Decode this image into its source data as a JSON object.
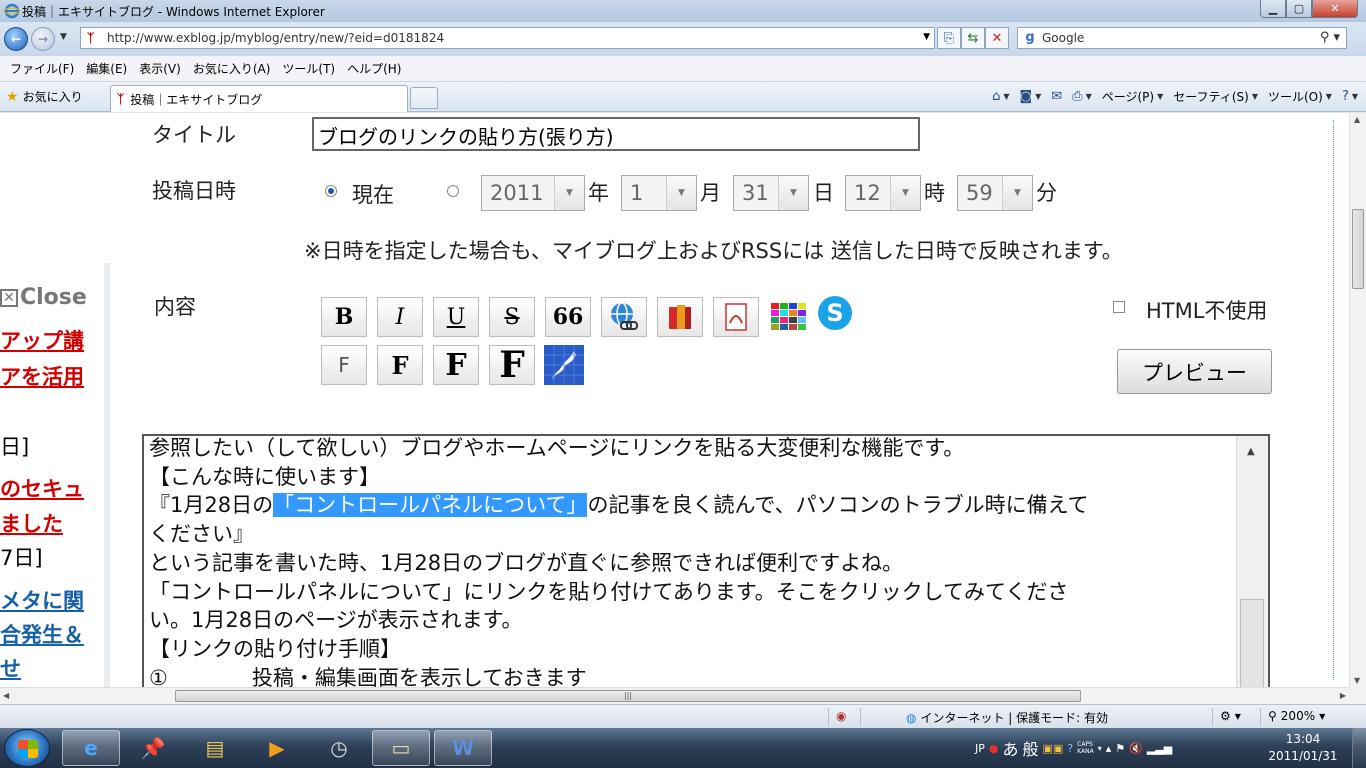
{
  "window": {
    "title": "投稿｜エキサイトブログ - Windows Internet Explorer"
  },
  "address_bar": {
    "url": "http://www.exblog.jp/myblog/entry/new/?eid=d0181824",
    "search_placeholder": "Google"
  },
  "menu": {
    "items": [
      "ファイル(F)",
      "編集(E)",
      "表示(V)",
      "お気に入り(A)",
      "ツール(T)",
      "ヘルプ(H)"
    ]
  },
  "favorites_bar": {
    "favorites_label": "お気に入り",
    "tab_label": "投稿｜エキサイトブログ",
    "page_menu": "ページ(P)",
    "safety_menu": "セーフティ(S)",
    "tools_menu": "ツール(O)"
  },
  "left_panel": {
    "close_label": "Close",
    "items": [
      {
        "text": "アップ講",
        "style": "red"
      },
      {
        "text": "アを活用",
        "style": "red"
      },
      {
        "text": "日]",
        "style": "plain"
      },
      {
        "text": "のセキュ",
        "style": "red"
      },
      {
        "text": "ました",
        "style": "red"
      },
      {
        "text": "7日]",
        "style": "plain"
      },
      {
        "text": "メタに関",
        "style": "blue"
      },
      {
        "text": "合発生＆",
        "style": "blue"
      },
      {
        "text": "せ",
        "style": "blue"
      }
    ]
  },
  "form": {
    "title_label": "タイトル",
    "title_value": "ブログのリンクの貼り方(張り方)",
    "datetime_label": "投稿日時",
    "now_label": "現在",
    "year": "2011",
    "year_unit": "年",
    "month": "1",
    "month_unit": "月",
    "day": "31",
    "day_unit": "日",
    "hour": "12",
    "hour_unit": "時",
    "minute": "59",
    "minute_unit": "分",
    "note": "※日時を指定した場合も、マイブログ上およびRSSには 送信した日時で反映されます。",
    "content_label": "内容",
    "html_disable_label": "HTML不使用",
    "preview_label": "プレビュー"
  },
  "toolbar_buttons": {
    "bold": "B",
    "italic": "I",
    "underline": "U",
    "strike": "S",
    "quote": "66",
    "font_f1": "F",
    "font_f2": "F",
    "font_f3": "F",
    "font_f4": "F"
  },
  "editor": {
    "lines": [
      {
        "pre": "参照したい（して欲しい）ブログやホームページにリンクを貼る大変便利な機能です。",
        "hl": "",
        "post": ""
      },
      {
        "pre": "【こんな時に使います】",
        "hl": "",
        "post": ""
      },
      {
        "pre": "『1月28日の",
        "hl": "「コントロールパネルについて」",
        "post": "の記事を良く読んで、パソコンのトラブル時に備えて"
      },
      {
        "pre": "ください』",
        "hl": "",
        "post": ""
      },
      {
        "pre": "という記事を書いた時、1月28日のブログが直ぐに参照できれば便利ですよね。",
        "hl": "",
        "post": ""
      },
      {
        "pre": "「コントロールパネルについて」にリンクを貼り付けてあります。そこをクリックしてみてくださ",
        "hl": "",
        "post": ""
      },
      {
        "pre": "い。1月28日のページが表示されます。",
        "hl": "",
        "post": ""
      },
      {
        "pre": "【リンクの貼り付け手順】",
        "hl": "",
        "post": ""
      },
      {
        "pre": "①　　　　投稿・編集画面を表示しておきます",
        "hl": "",
        "post": ""
      }
    ]
  },
  "statusbar": {
    "zone": "インターネット | 保護モード: 有効",
    "zoom": "200%"
  },
  "taskbar": {
    "lang": "JP",
    "ime_mode1": "あ",
    "ime_mode2": "般",
    "caps": "CAPS",
    "kana": "KANA",
    "time": "13:04",
    "date": "2011/01/31"
  },
  "colors": {
    "selection": "#3399ff",
    "link_red": "#d40000",
    "link_blue": "#1560a8"
  }
}
